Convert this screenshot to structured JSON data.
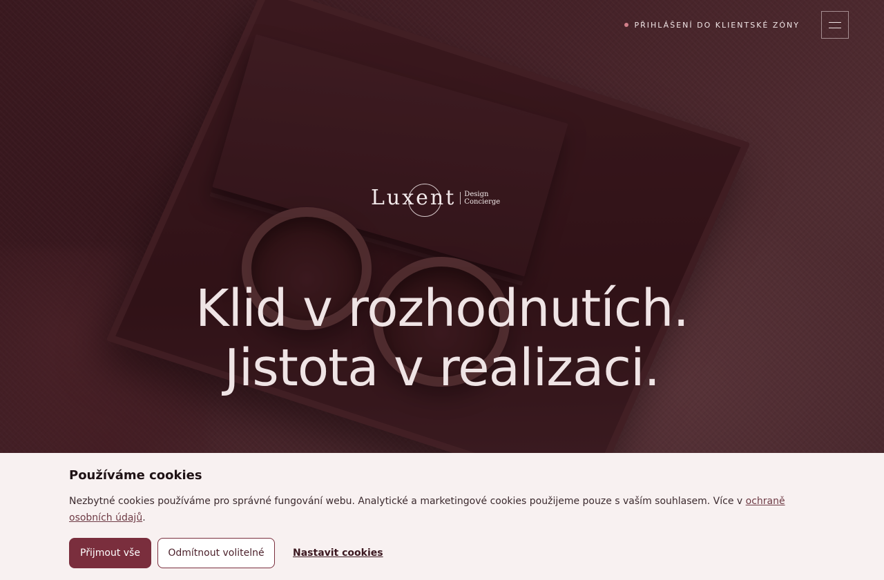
{
  "header": {
    "client_zone_link": "PŘIHLÁŠENÍ DO KLIENTSKÉ ZÓNY",
    "menu_icon": "hamburger-icon"
  },
  "logo": {
    "wordmark": "Luxent",
    "sub_line_1": "Design",
    "sub_line_2": "Concierge"
  },
  "hero": {
    "headline_line_1": "Klid v rozhodnutích.",
    "headline_line_2": "Jistota v realizaci."
  },
  "cookie_banner": {
    "title": "Používáme cookies",
    "text_before_link": "Nezbytné cookies používáme pro správné fungování webu. Analytické a marketingové cookies použijeme pouze s vaším souhlasem. Více v ",
    "link_text": "ochraně osobních údajů",
    "text_after_link": ".",
    "accept_all": "Přijmout vše",
    "reject_optional": "Odmítnout volitelné",
    "settings": "Nastavit cookies"
  },
  "colors": {
    "accent": "#7a2e3d",
    "banner_background": "#f8f1f1",
    "dot": "#d27f8a"
  }
}
